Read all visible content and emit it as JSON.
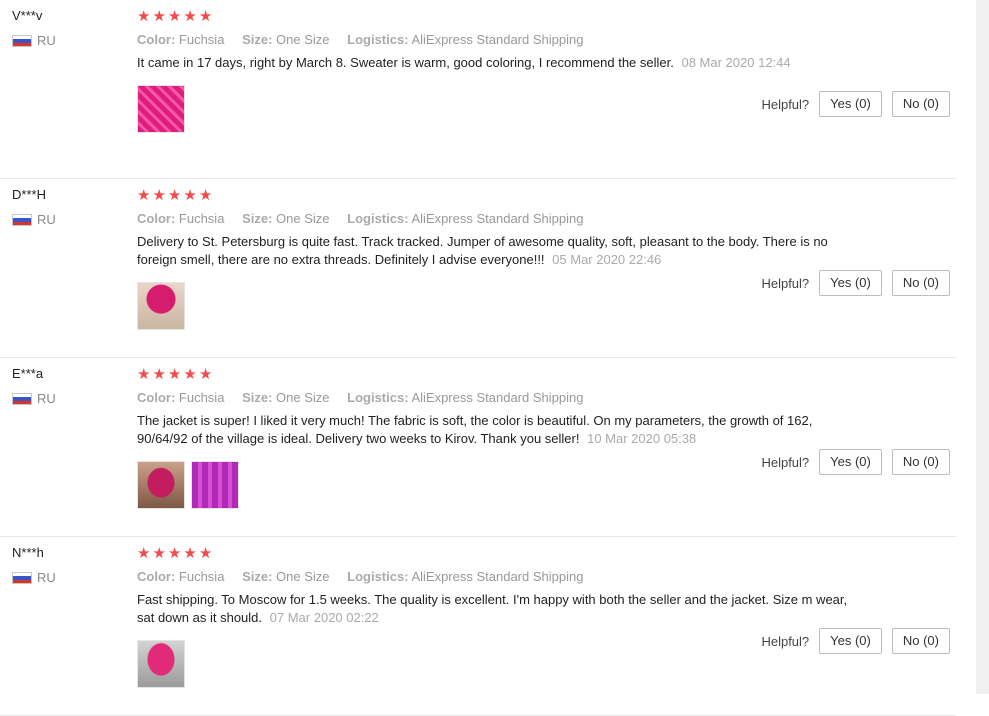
{
  "labels": {
    "color": "Color:",
    "size": "Size:",
    "logistics": "Logistics:",
    "helpful": "Helpful?"
  },
  "reviews": [
    {
      "user": "V***v",
      "country": "RU",
      "rating": 5,
      "color": "Fuchsia",
      "size": "One Size",
      "logistics": "AliExpress Standard Shipping",
      "text": "It came in 17 days, right by March 8. Sweater is warm, good coloring, I recommend the seller.",
      "date": "08 Mar 2020 12:44",
      "yes": "Yes (0)",
      "no": "No (0)"
    },
    {
      "user": "D***H",
      "country": "RU",
      "rating": 5,
      "color": "Fuchsia",
      "size": "One Size",
      "logistics": "AliExpress Standard Shipping",
      "text": "Delivery to St. Petersburg is quite fast. Track tracked. Jumper of awesome quality, soft, pleasant to the body. There is no foreign smell, there are no extra threads. Definitely I advise everyone!!!",
      "date": "05 Mar 2020 22:46",
      "yes": "Yes (0)",
      "no": "No (0)"
    },
    {
      "user": "E***a",
      "country": "RU",
      "rating": 5,
      "color": "Fuchsia",
      "size": "One Size",
      "logistics": "AliExpress Standard Shipping",
      "text": "The jacket is super! I liked it very much! The fabric is soft, the color is beautiful. On my parameters, the growth of 162, 90/64/92 of the village is ideal. Delivery two weeks to Kirov. Thank you seller!",
      "date": "10 Mar 2020 05:38",
      "yes": "Yes (0)",
      "no": "No (0)"
    },
    {
      "user": "N***h",
      "country": "RU",
      "rating": 5,
      "color": "Fuchsia",
      "size": "One Size",
      "logistics": "AliExpress Standard Shipping",
      "text": "Fast shipping. To Moscow for 1.5 weeks. The quality is excellent. I'm happy with both the seller and the jacket. Size m wear, sat down as it should.",
      "date": "07 Mar 2020 02:22",
      "yes": "Yes (0)",
      "no": "No (0)"
    }
  ]
}
